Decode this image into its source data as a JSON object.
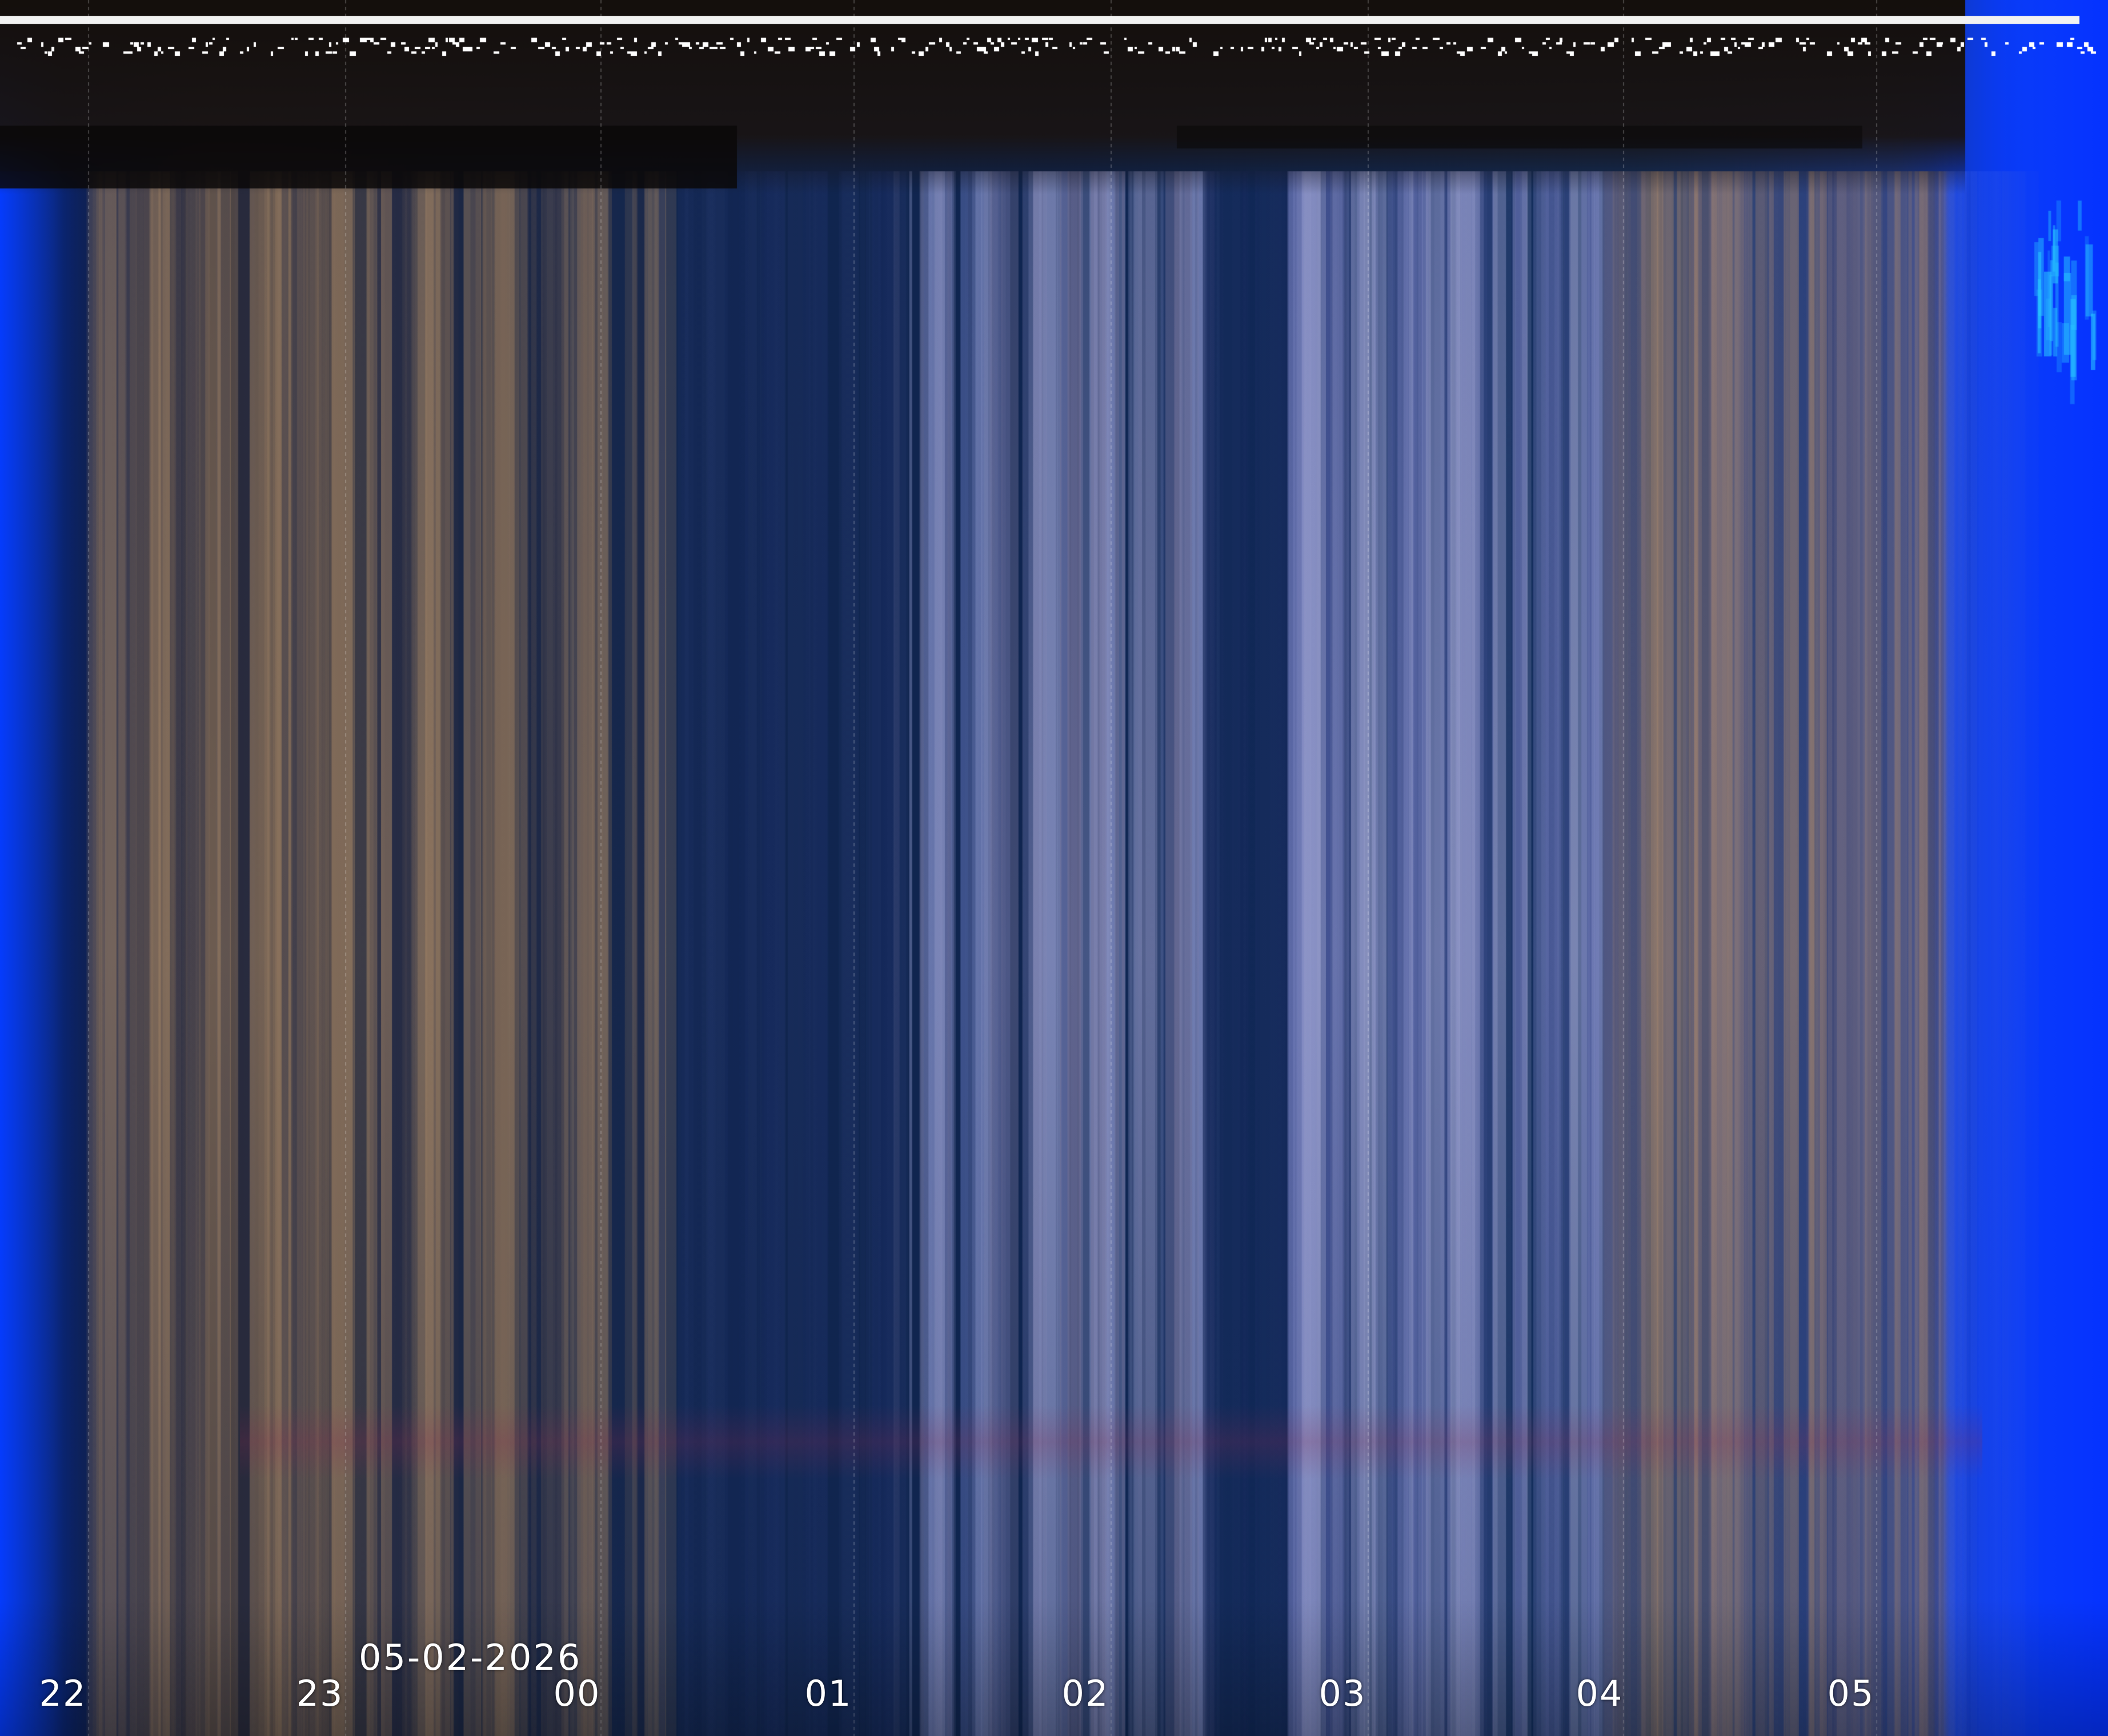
{
  "date_label": "05-02-2026",
  "hour_labels": [
    "22",
    "23",
    "00",
    "01",
    "02",
    "03",
    "04",
    "05"
  ]
}
